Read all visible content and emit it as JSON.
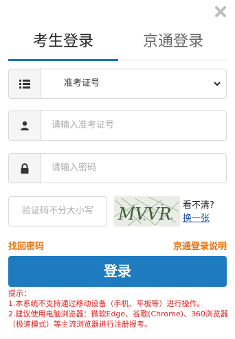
{
  "header": {
    "close_icon": "close-icon"
  },
  "tabs": [
    {
      "label": "考生登录",
      "active": true
    },
    {
      "label": "京通登录",
      "active": false
    }
  ],
  "form": {
    "id_type": {
      "selected": "准考证号",
      "icon": "list-icon"
    },
    "id_number": {
      "placeholder": "请输入准考证号",
      "icon": "user-icon"
    },
    "password": {
      "placeholder": "请输入密码",
      "icon": "lock-icon"
    },
    "captcha": {
      "placeholder": "验证码不分大小写",
      "image_text": "MVVR",
      "hint": "看不清?",
      "refresh": "换一张"
    }
  },
  "links": {
    "forgot_password": "找回密码",
    "jingtong_help": "京通登录说明"
  },
  "login_button": "登录",
  "notice": {
    "title": "提示：",
    "lines": [
      "1.本系统不支持通过移动设备（手机、平板等）进行操作。",
      "2.建议使用电脑浏览器：微软Edge、谷歌(Chrome)、360浏览器（极速模式）等主流浏览器进行注册报考。"
    ]
  },
  "colors": {
    "accent": "#1f7bc0",
    "link": "#e8720c",
    "warning": "#e02020"
  }
}
